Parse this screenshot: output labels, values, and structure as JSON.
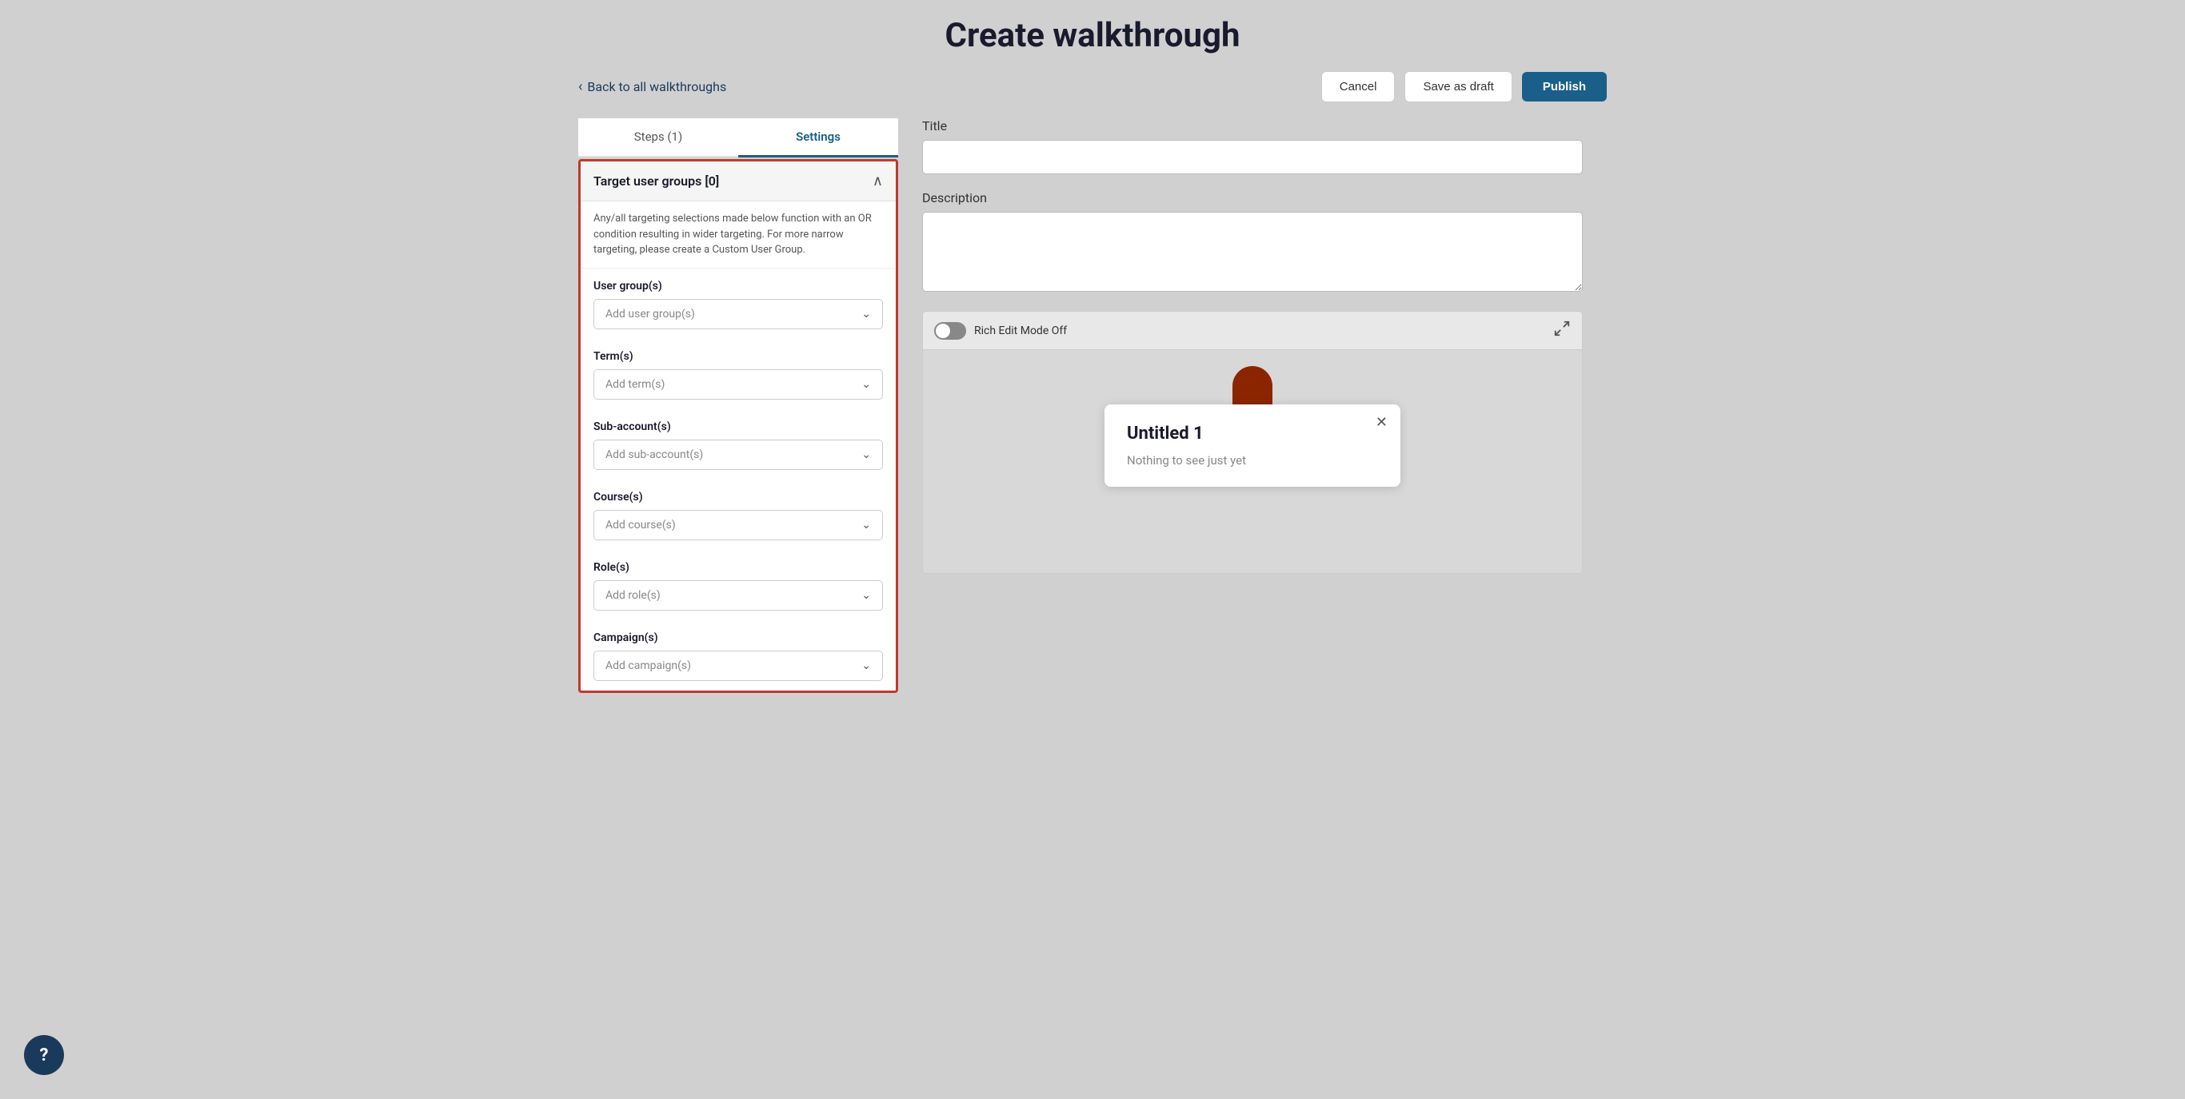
{
  "page": {
    "title": "Create walkthrough"
  },
  "header": {
    "back_label": "Back to all walkthroughs",
    "cancel_label": "Cancel",
    "draft_label": "Save as draft",
    "publish_label": "Publish"
  },
  "tabs": [
    {
      "label": "Steps (1)",
      "active": false
    },
    {
      "label": "Settings",
      "active": true
    }
  ],
  "target_panel": {
    "title": "Target user groups [0]",
    "description": "Any/all targeting selections made below function with an OR condition resulting in wider targeting. For more narrow targeting, please create a Custom User Group.",
    "sections": [
      {
        "label": "User group(s)",
        "placeholder": "Add user group(s)"
      },
      {
        "label": "Term(s)",
        "placeholder": "Add term(s)"
      },
      {
        "label": "Sub-account(s)",
        "placeholder": "Add sub-account(s)"
      },
      {
        "label": "Course(s)",
        "placeholder": "Add course(s)"
      },
      {
        "label": "Role(s)",
        "placeholder": "Add role(s)"
      },
      {
        "label": "Campaign(s)",
        "placeholder": "Add campaign(s)"
      }
    ]
  },
  "right_panel": {
    "title_label": "Title",
    "title_placeholder": "",
    "description_label": "Description",
    "description_placeholder": "",
    "rich_edit_label": "Rich Edit Mode Off",
    "rich_edit_on": false
  },
  "walkthrough_card": {
    "title": "Untitled 1",
    "body": "Nothing to see just yet"
  },
  "help": {
    "icon": "?"
  }
}
